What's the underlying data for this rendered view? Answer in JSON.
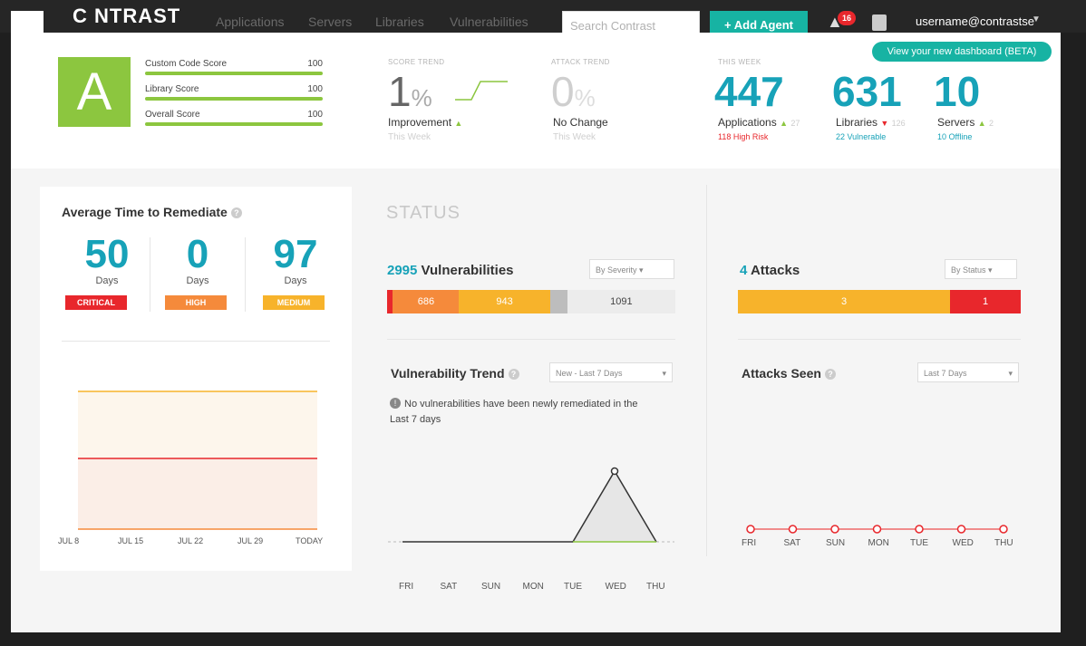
{
  "nav": {
    "logo": "C NTRAST",
    "items": [
      "Applications",
      "Servers",
      "Libraries",
      "Vulnerabilities"
    ],
    "search_placeholder": "Search Contrast",
    "add_agent": "+ Add Agent",
    "notifications": "16",
    "username": "username@contrastse"
  },
  "score": {
    "grade": "A",
    "rows": [
      {
        "label": "Custom Code Score",
        "value": "100"
      },
      {
        "label": "Library Score",
        "value": "100"
      },
      {
        "label": "Overall Score",
        "value": "100"
      }
    ]
  },
  "score_trend": {
    "label": "SCORE TREND",
    "value": "1",
    "unit": "%",
    "caption": "Improvement",
    "sub": "This Week"
  },
  "attack_trend": {
    "label": "ATTACK TREND",
    "value": "0",
    "unit": "%",
    "caption": "No Change",
    "sub": "This Week"
  },
  "this_week": {
    "label": "THIS WEEK",
    "view_dashboard": "View your new dashboard (BETA)",
    "stats": [
      {
        "value": "447",
        "label": "Applications",
        "delta": "27",
        "sub": "118 High Risk",
        "sub_color": "#e8272c"
      },
      {
        "value": "631",
        "label": "Libraries",
        "delta": "126",
        "sub": "22 Vulnerable",
        "sub_color": "#17a2b8"
      },
      {
        "value": "10",
        "label": "Servers",
        "delta": "2",
        "sub": "10 Offline",
        "sub_color": "#17a2b8"
      }
    ]
  },
  "remediate": {
    "title": "Average Time to Remediate",
    "items": [
      {
        "value": "50",
        "unit": "Days",
        "severity": "CRITICAL",
        "color": "#e8272c"
      },
      {
        "value": "0",
        "unit": "Days",
        "severity": "HIGH",
        "color": "#f58a3b"
      },
      {
        "value": "97",
        "unit": "Days",
        "severity": "MEDIUM",
        "color": "#f7b32b"
      }
    ],
    "x_labels": [
      "JUL 8",
      "JUL 15",
      "JUL 22",
      "JUL 29",
      "TODAY"
    ]
  },
  "status": {
    "title": "STATUS",
    "vulnerabilities": {
      "count": "2995",
      "label": "Vulnerabilities",
      "dropdown": "By Severity",
      "segments": [
        {
          "value": "",
          "share": 0.02,
          "color": "#e8272c"
        },
        {
          "value": "686",
          "share": 0.23,
          "color": "#f58a3b"
        },
        {
          "value": "943",
          "share": 0.315,
          "color": "#f7b32b"
        },
        {
          "value": "",
          "share": 0.06,
          "color": "#bdbdbd"
        },
        {
          "value": "1091",
          "share": 0.375,
          "color": "#ececec"
        }
      ]
    },
    "attacks": {
      "count": "4",
      "label": "Attacks",
      "dropdown": "By Status",
      "segments": [
        {
          "value": "3",
          "share": 0.75,
          "color": "#f7b32b"
        },
        {
          "value": "1",
          "share": 0.25,
          "color": "#e8272c"
        }
      ]
    }
  },
  "vuln_trend": {
    "title": "Vulnerability Trend",
    "dropdown": "New - Last 7 Days",
    "note": "No vulnerabilities have been newly remediated in the Last 7 days",
    "days": [
      "FRI",
      "SAT",
      "SUN",
      "MON",
      "TUE",
      "WED",
      "THU"
    ]
  },
  "attacks_seen": {
    "title": "Attacks Seen",
    "dropdown": "Last 7 Days",
    "days": [
      "FRI",
      "SAT",
      "SUN",
      "MON",
      "TUE",
      "WED",
      "THU"
    ]
  },
  "colors": {
    "accent": "#17b3a3",
    "teal_text": "#17a2b8",
    "grade_green": "#8cc63f",
    "critical": "#e8272c",
    "high": "#f58a3b",
    "medium": "#f7b32b"
  }
}
